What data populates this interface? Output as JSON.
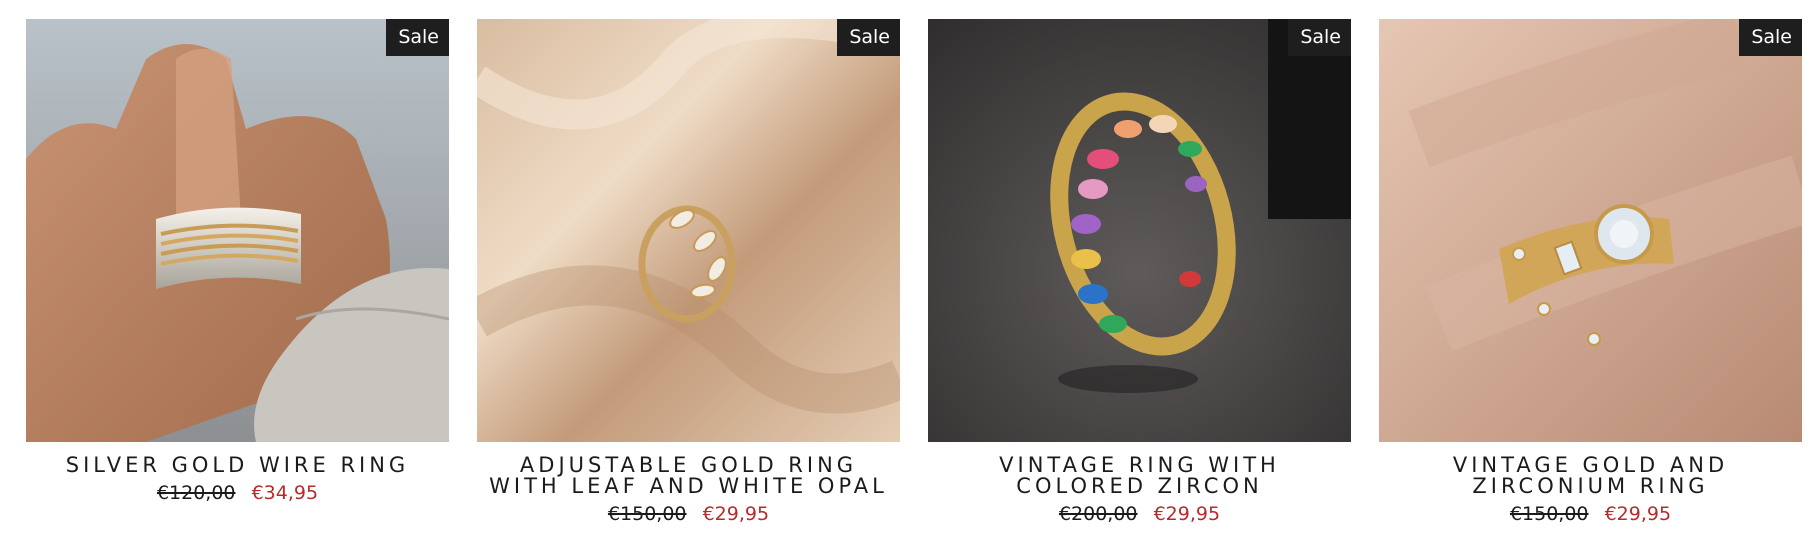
{
  "products": [
    {
      "badge": "Sale",
      "title": "Silver Gold Wire Ring",
      "price_old": "€120,00",
      "price_new": "€34,95",
      "image": "hand wearing a silver ring wrapped in gold wire"
    },
    {
      "badge": "Sale",
      "title": "Adjustable Gold Ring With Leaf And White Opal",
      "price_old": "€150,00",
      "price_new": "€29,95",
      "image": "gold leaf ring with white opal on satin fabric"
    },
    {
      "badge": "Sale",
      "title": "Vintage Ring With Colored Zircon",
      "price_old": "€200,00",
      "price_new": "€29,95",
      "image": "gold eternity ring set with multicolored zircon stones"
    },
    {
      "badge": "Sale",
      "title": "Vintage Gold And Zirconium Ring",
      "price_old": "€150,00",
      "price_new": "€29,95",
      "image": "hand wearing stacked gold rings with zirconia"
    }
  ],
  "colors": {
    "badge_bg": "#1e1e1e",
    "sale_price": "#b52b2b",
    "text": "#1b1b1b"
  }
}
